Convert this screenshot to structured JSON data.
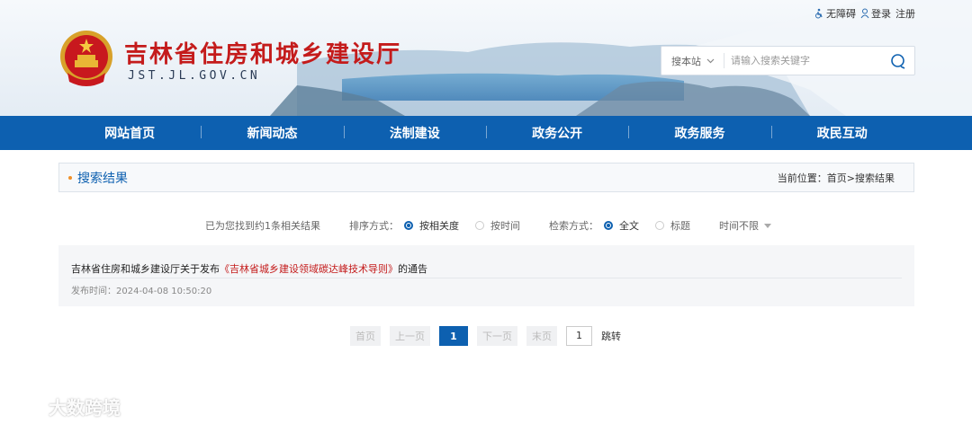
{
  "toplinks": {
    "accessibility": "无障碍",
    "login": "登录",
    "register": "注册"
  },
  "site": {
    "title": "吉林省住房和城乡建设厅",
    "url": "JST.JL.GOV.CN"
  },
  "search": {
    "scope": "搜本站",
    "placeholder": "请输入搜索关键字"
  },
  "nav": [
    "网站首页",
    "新闻动态",
    "法制建设",
    "政务公开",
    "政务服务",
    "政民互动"
  ],
  "results_bar": {
    "title": "搜索结果",
    "location_label": "当前位置：",
    "home": "首页",
    "sep": ">",
    "current": "搜索结果"
  },
  "filters": {
    "found": "已为您找到约1条相关结果",
    "sort_label": "排序方式：",
    "sort_relevance": "按相关度",
    "sort_time": "按时间",
    "mode_label": "检索方式：",
    "mode_full": "全文",
    "mode_title": "标题",
    "time_limit": "时间不限"
  },
  "result": {
    "prefix": "吉林省住房和城乡建设厅关于发布",
    "highlight": "《吉林省城乡建设领域碳达峰技术导则》",
    "suffix": "的通告",
    "date": "发布时间：2024-04-08 10:50:20"
  },
  "pager": {
    "first": "首页",
    "prev": "上一页",
    "current": "1",
    "next": "下一页",
    "last": "末页",
    "input": "1",
    "jump": "跳转"
  },
  "watermark": "大数跨境",
  "colors": {
    "primary": "#0d60b0",
    "title_red": "#c41b1b",
    "accent_orange": "#f0902a"
  }
}
